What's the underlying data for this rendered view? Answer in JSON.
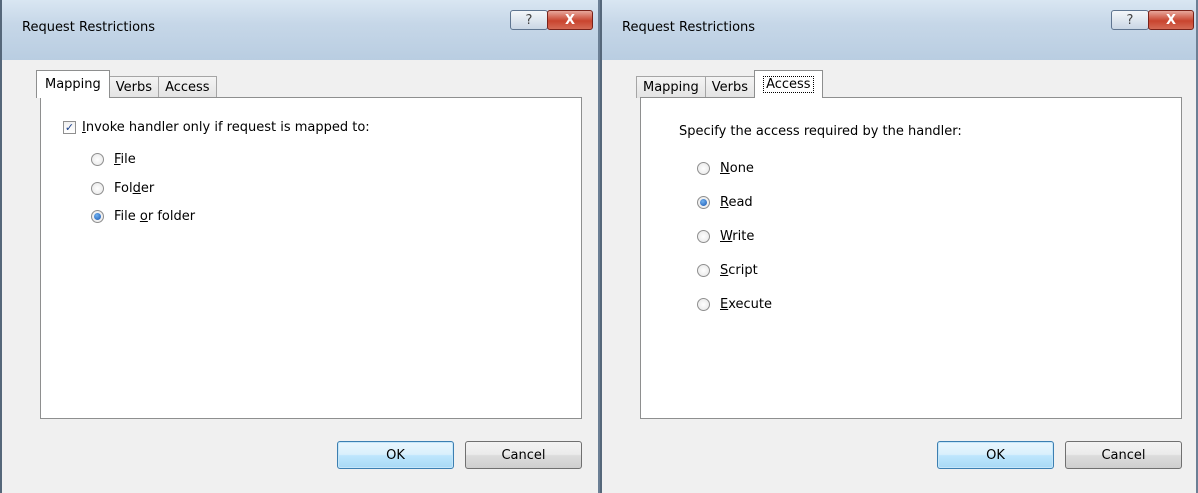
{
  "left_dialog": {
    "title": "Request Restrictions",
    "help_label": "?",
    "close_label": "X",
    "tabs": [
      {
        "label": "Mapping",
        "active": true
      },
      {
        "label": "Verbs",
        "active": false
      },
      {
        "label": "Access",
        "active": false
      }
    ],
    "checkbox": {
      "pre": "",
      "mnemonic": "I",
      "post": "nvoke handler only if request is mapped to:",
      "checked": true
    },
    "options": [
      {
        "pre": "",
        "mnemonic": "F",
        "post": "ile",
        "selected": false
      },
      {
        "pre": "Fol",
        "mnemonic": "d",
        "post": "er",
        "selected": false
      },
      {
        "pre": "File ",
        "mnemonic": "o",
        "post": "r folder",
        "selected": true
      }
    ],
    "ok_label": "OK",
    "cancel_label": "Cancel"
  },
  "right_dialog": {
    "title": "Request Restrictions",
    "help_label": "?",
    "close_label": "X",
    "tabs": [
      {
        "label": "Mapping",
        "active": false
      },
      {
        "label": "Verbs",
        "active": false
      },
      {
        "label": "Access",
        "active": true
      }
    ],
    "heading": "Specify the access required by the handler:",
    "options": [
      {
        "pre": "",
        "mnemonic": "N",
        "post": "one",
        "selected": false
      },
      {
        "pre": "",
        "mnemonic": "R",
        "post": "ead",
        "selected": true
      },
      {
        "pre": "",
        "mnemonic": "W",
        "post": "rite",
        "selected": false
      },
      {
        "pre": "",
        "mnemonic": "S",
        "post": "cript",
        "selected": false
      },
      {
        "pre": "",
        "mnemonic": "E",
        "post": "xecute",
        "selected": false
      }
    ],
    "ok_label": "OK",
    "cancel_label": "Cancel"
  }
}
